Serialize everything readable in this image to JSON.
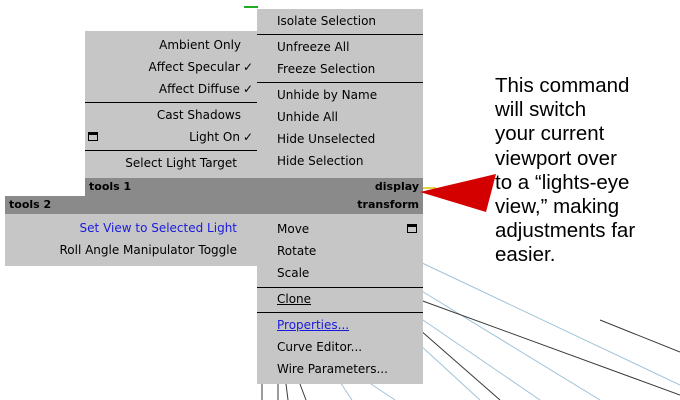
{
  "menu_left_upper": {
    "items": [
      {
        "label": "Ambient Only",
        "checked": false
      },
      {
        "label": "Affect Specular",
        "checked": true
      },
      {
        "label": "Affect Diffuse",
        "checked": true
      },
      {
        "label": "Cast Shadows",
        "checked": false
      },
      {
        "label": "Light On",
        "checked": true,
        "icon": "window-icon"
      },
      {
        "label": "Select Light Target",
        "checked": false
      }
    ],
    "check_glyph": "✓"
  },
  "menu_right_upper": {
    "items": [
      "Isolate Selection",
      "Unfreeze All",
      "Freeze Selection",
      "Unhide by Name",
      "Unhide All",
      "Hide Unselected",
      "Hide Selection"
    ]
  },
  "quad_labels": {
    "tools1": "tools 1",
    "display": "display",
    "tools2": "tools 2",
    "transform": "transform"
  },
  "menu_left_lower": {
    "items": [
      "Set View to Selected Light",
      "Roll Angle Manipulator Toggle"
    ]
  },
  "menu_right_lower": {
    "items": [
      "Move",
      "Rotate",
      "Scale",
      "Clone",
      "Properties...",
      "Curve Editor...",
      "Wire Parameters..."
    ]
  },
  "caption": {
    "lines": [
      "This command",
      "will switch",
      "your current",
      "viewport over",
      "to a “lights-eye",
      "view,” making",
      "adjustments far",
      "easier."
    ]
  },
  "colors": {
    "menu_bg": "#c6c6c6",
    "header_bg": "#8a8a8a",
    "highlight_text": "#1a1adc",
    "arrow": "#d40000",
    "viewport_lines": "#9ec3d8"
  }
}
